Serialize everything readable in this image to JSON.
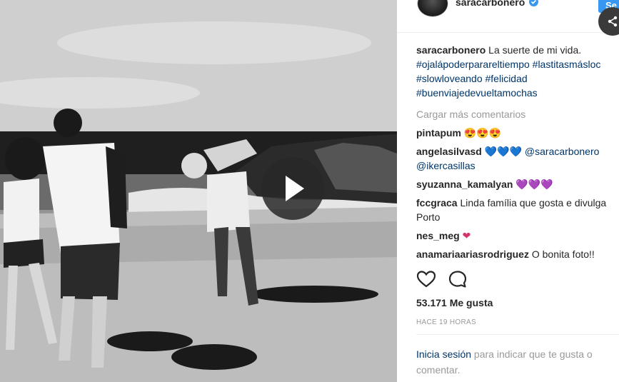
{
  "post": {
    "username": "saracarbonero",
    "follow_label": "Se",
    "caption_text": "La suerte de mi vida.",
    "hashtags_line1": "#ojalápoderparareltiempo #lastitasmásloc",
    "hashtags_line2": "#slowloveando #felicidad",
    "hashtags_line3": "#buenviajedevueltamochas",
    "load_more": "Cargar más comentarios",
    "likes": "53.171 Me gusta",
    "time": "HACE 19 HORAS",
    "login_link": "Inicia sesión",
    "login_rest": " para indicar que te gusta o comentar."
  },
  "comments": [
    {
      "user": "pintapum",
      "text": "",
      "emoji": "😍😍😍"
    },
    {
      "user": "angelasilvasd",
      "emoji": "💙💙💙",
      "mention1": "@saracarbonero",
      "mention2": "@ikercasillas"
    },
    {
      "user": "syuzanna_kamalyan",
      "emoji": "💜💜💜"
    },
    {
      "user": "fccgraca",
      "text": "Linda família que gosta e divulga",
      "text2": "Porto"
    },
    {
      "user": "nes_meg",
      "emoji": "❤"
    },
    {
      "user": "anamariaariasrodriguez",
      "text": "O bonita foto!!"
    }
  ],
  "icons": {
    "play": "play-icon",
    "verified": "verified-badge-icon",
    "share": "share-icon",
    "like": "heart-icon",
    "comment": "comment-icon"
  },
  "colors": {
    "accent": "#3897f0",
    "link": "#003569",
    "muted": "#999999"
  }
}
